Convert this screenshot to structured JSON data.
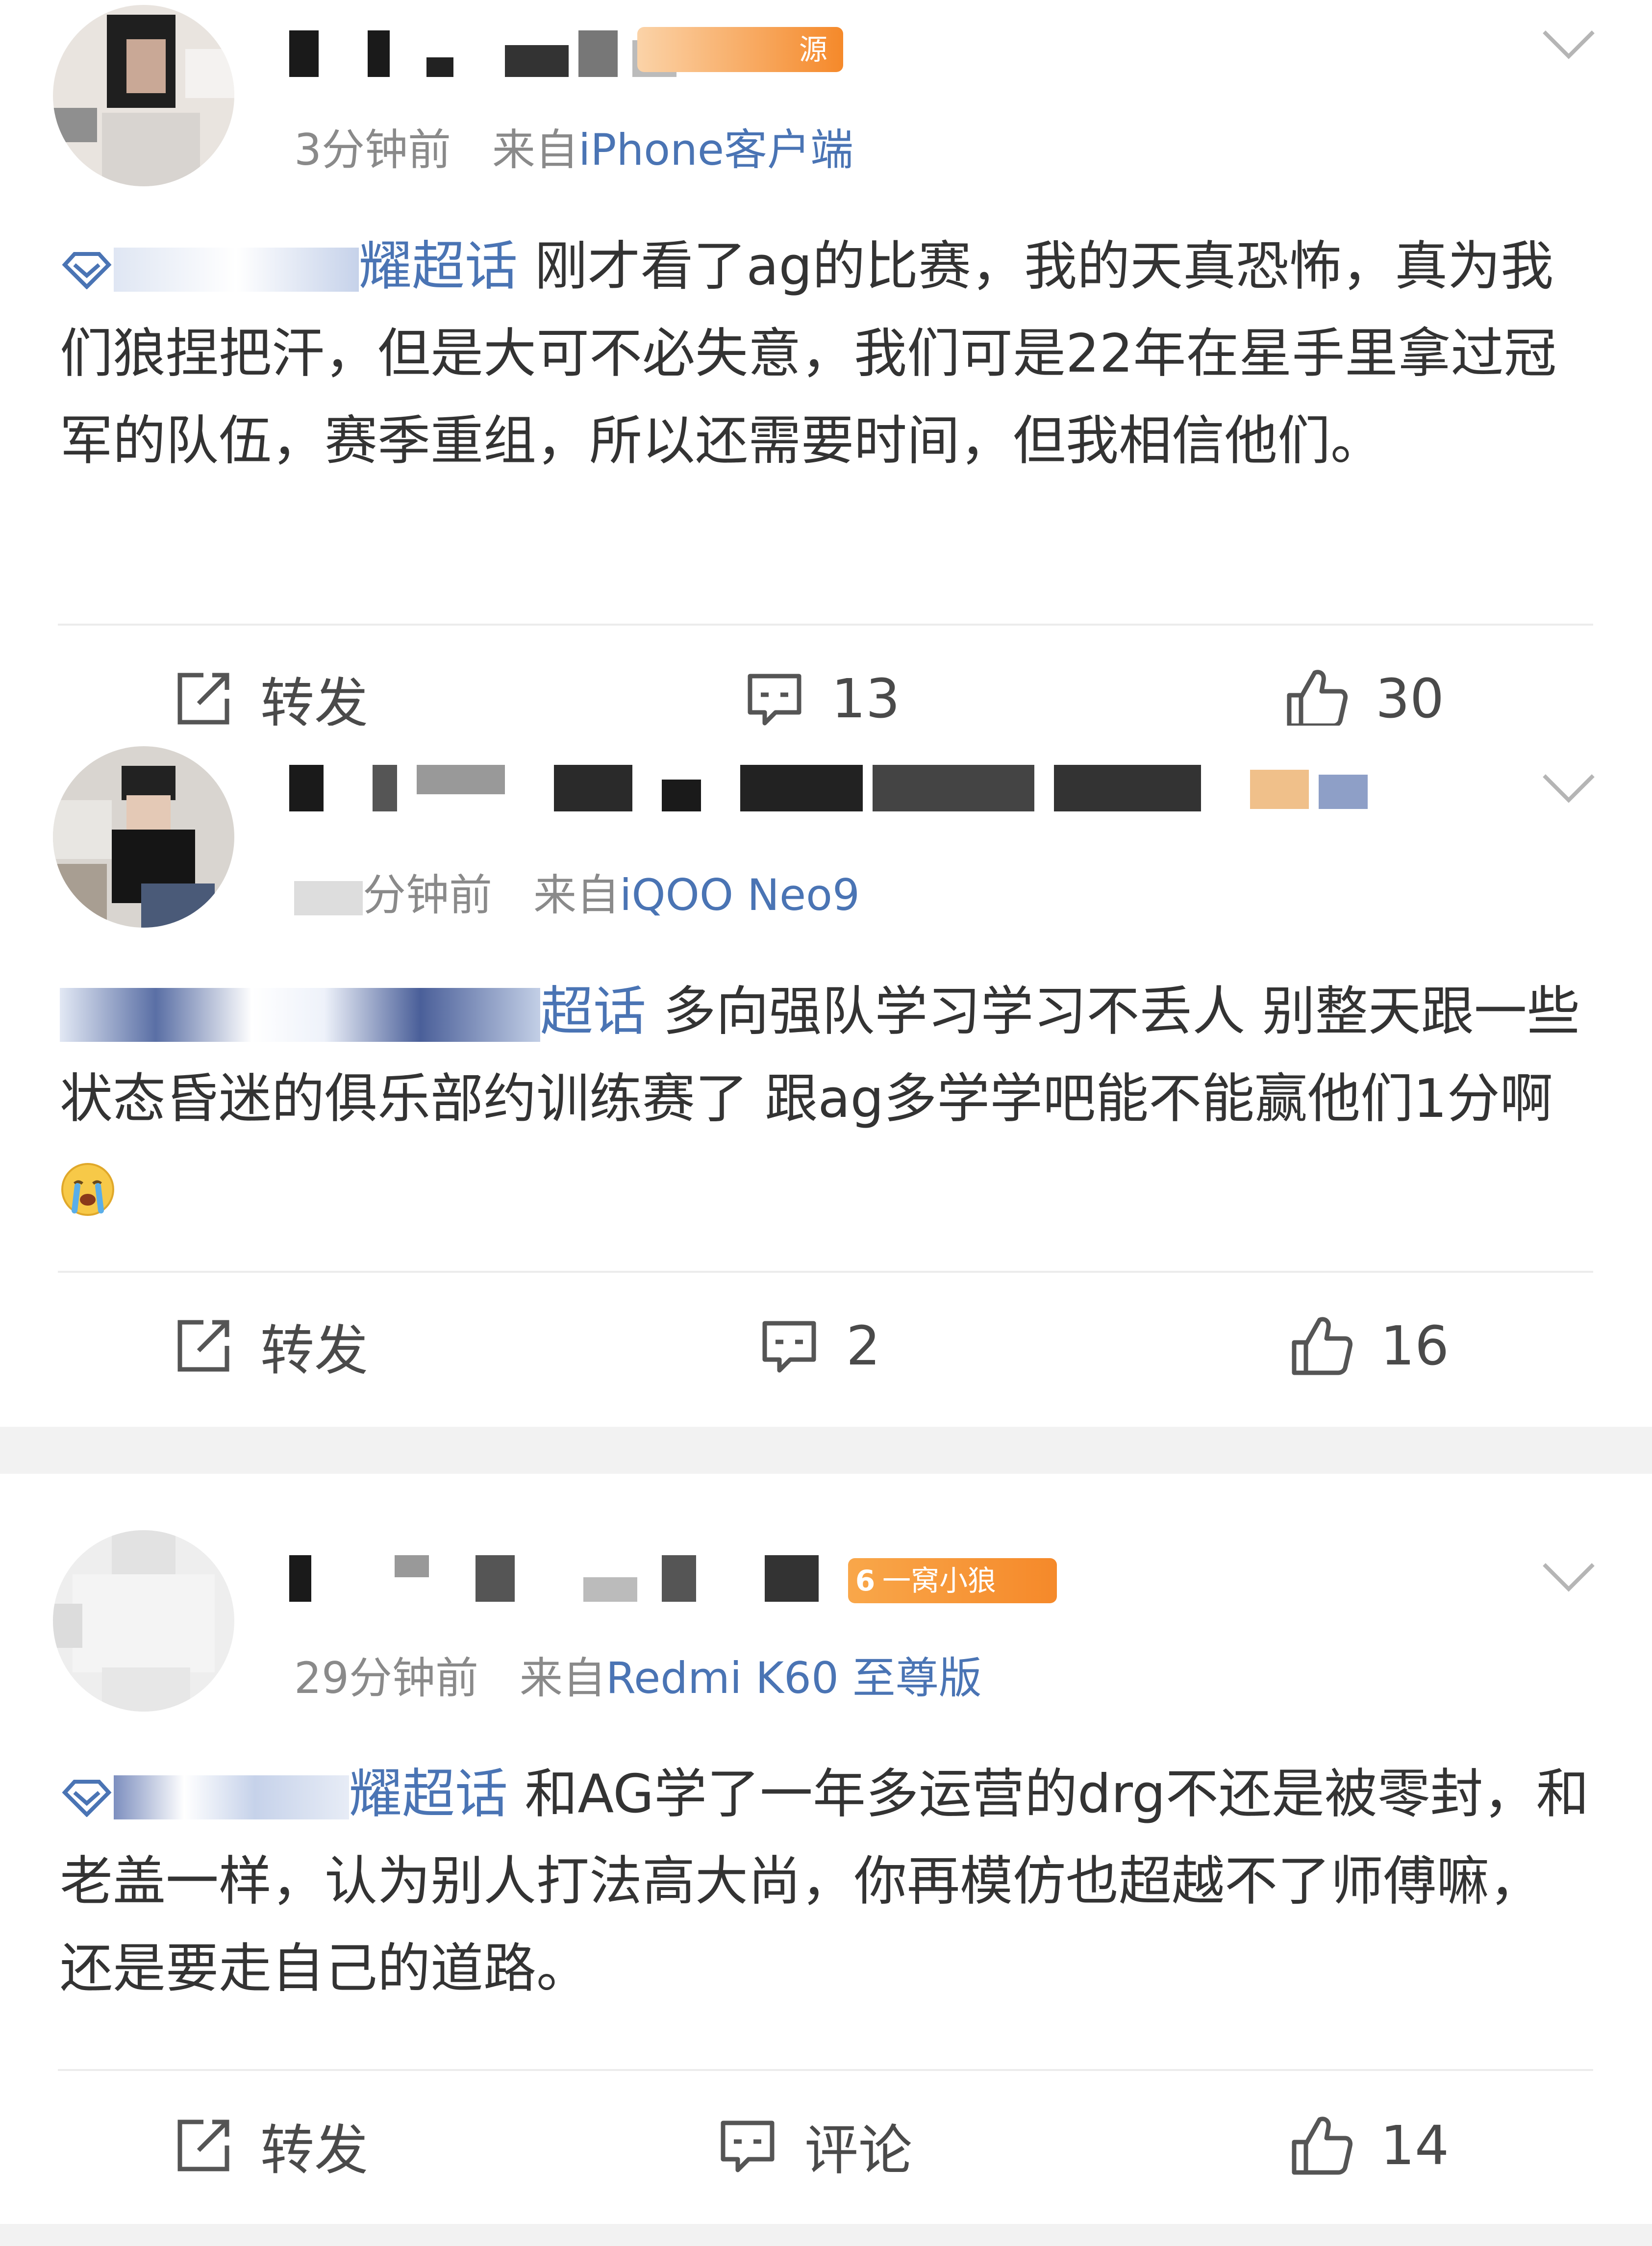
{
  "posts": [
    {
      "time": "3分钟前",
      "source_prefix": "来自",
      "source": "iPhone客户端",
      "badge": "源",
      "topic": "耀超话",
      "text": "刚才看了ag的比赛，我的天真恐怖，真为我们狼捏把汗，但是大可不必失意，我们可是22年在星手里拿过冠军的队伍，赛季重组，所以还需要时间，但我相信他们。",
      "repost_label": "转发",
      "comment_label": "13",
      "like_count": "30"
    },
    {
      "time": "分钟前",
      "source_prefix": "来自",
      "source": "iQOO Neo9",
      "topic": "超话",
      "text": "多向强队学习学习不丢人  别整天跟一些状态昏迷的俱乐部约训练赛了  跟ag多学学吧能不能赢他们1分啊",
      "repost_label": "转发",
      "comment_label": "2",
      "like_count": "16"
    },
    {
      "time": "29分钟前",
      "source_prefix": "来自",
      "source": "Redmi K60 至尊版",
      "badge": "一窝小狼",
      "badge_level": "6",
      "topic": "耀超话",
      "text": "和AG学了一年多运营的drg不还是被零封，和老盖一样，认为别人打法高大尚，你再模仿也超越不了师傅嘛，还是要走自己的道路。",
      "repost_label": "转发",
      "comment_label": "评论",
      "like_count": "14"
    }
  ],
  "colors": {
    "link_blue": "#4a74b4",
    "meta_gray": "#8a8a8a",
    "text": "#333333",
    "badge_orange": "#f5892a",
    "divider": "#ececec",
    "gap_gray": "#f2f2f2"
  },
  "icons": [
    "avatar",
    "chevron-down-icon",
    "repost-icon",
    "comment-icon",
    "like-icon",
    "supertopic-icon",
    "crying-emoji"
  ]
}
